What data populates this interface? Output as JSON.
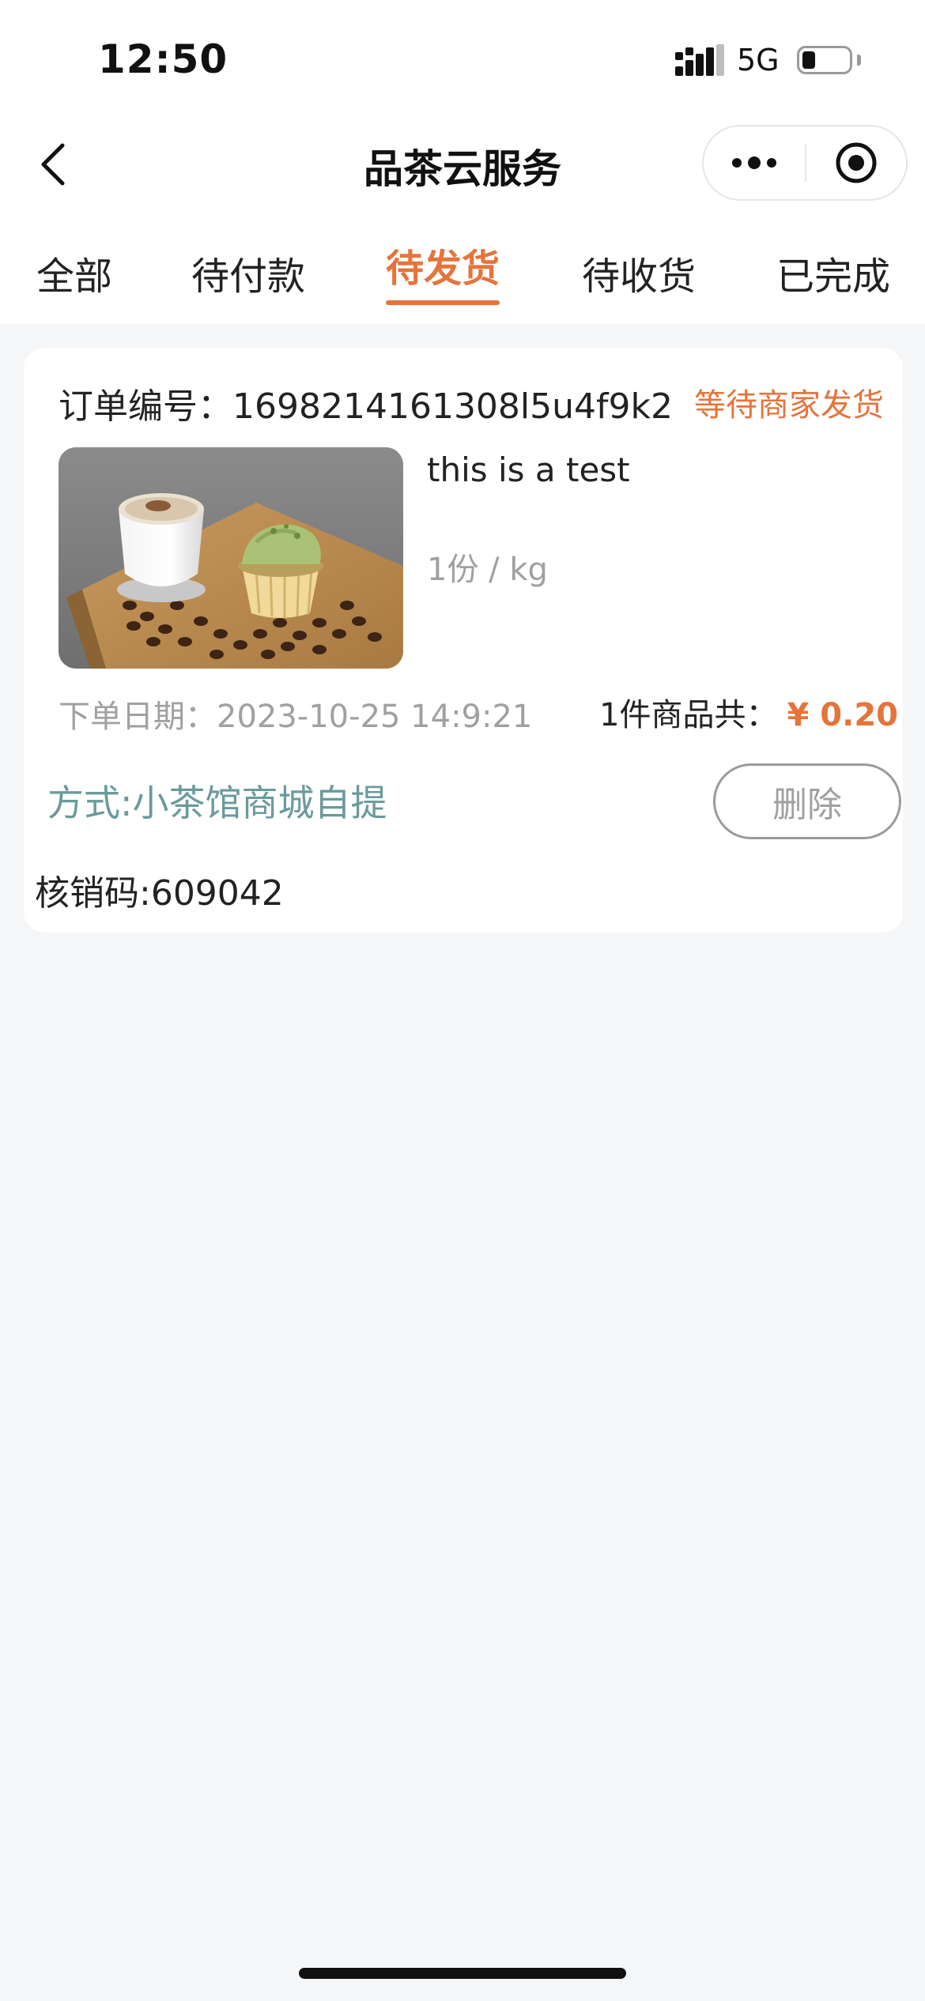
{
  "status_bar": {
    "time": "12:50",
    "network": "5G"
  },
  "nav": {
    "title": "品茶云服务",
    "back_icon": "chevron-left-icon",
    "more_icon": "more-dots-icon",
    "close_icon": "target-close-icon"
  },
  "tabs": [
    {
      "label": "全部",
      "active": false
    },
    {
      "label": "待付款",
      "active": false
    },
    {
      "label": "待发货",
      "active": true
    },
    {
      "label": "待收货",
      "active": false
    },
    {
      "label": "已完成",
      "active": false
    }
  ],
  "order": {
    "order_no_label": "订单编号：",
    "order_no": "1698214161308l5u4f9k2",
    "status": "等待商家发货",
    "product_name": "this is a test",
    "spec": "1份 / kg",
    "date_label": "下单日期：",
    "date": "2023-10-25 14:9:21",
    "summary_label": "1件商品共：",
    "price": "¥ 0.20",
    "method": "方式:小茶馆商城自提",
    "delete_label": "删除",
    "verify_code": "核销码:609042"
  },
  "colors": {
    "accent": "#e5743b",
    "method_text": "#6a9a9c",
    "muted_text": "#a0a0a0",
    "page_bg": "#f5f6f8"
  }
}
